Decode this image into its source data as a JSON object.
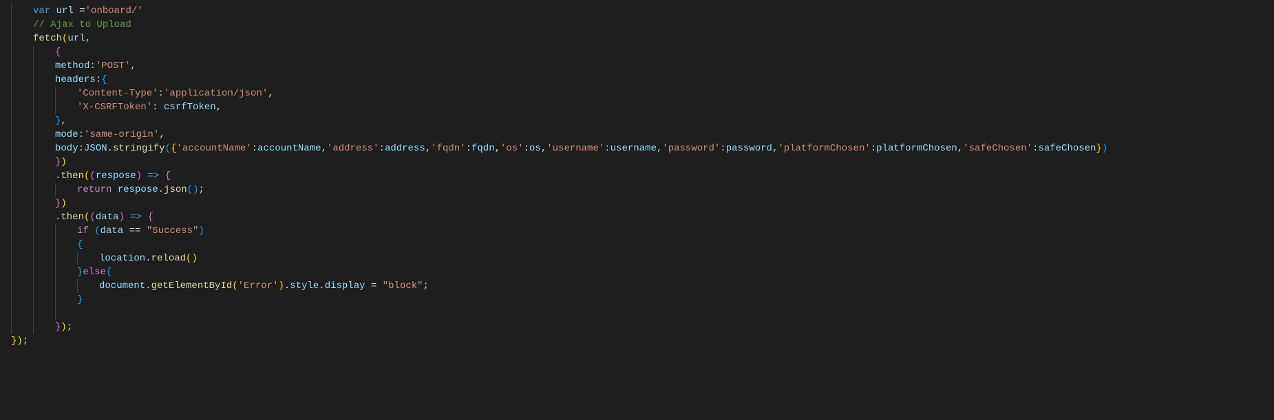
{
  "code": {
    "lines": [
      {
        "indent": 1,
        "tokens": [
          [
            "kw",
            "var"
          ],
          [
            "pn",
            " "
          ],
          [
            "id",
            "url"
          ],
          [
            "pn",
            " "
          ],
          [
            "pn",
            "="
          ],
          [
            "str",
            "'onboard/'"
          ]
        ]
      },
      {
        "indent": 1,
        "tokens": [
          [
            "cmt",
            "// Ajax to Upload"
          ]
        ]
      },
      {
        "indent": 1,
        "tokens": [
          [
            "fn",
            "fetch"
          ],
          [
            "y",
            "("
          ],
          [
            "id",
            "url"
          ],
          [
            "pn",
            ","
          ]
        ]
      },
      {
        "indent": 2,
        "tokens": [
          [
            "p",
            "{"
          ]
        ]
      },
      {
        "indent": 2,
        "tokens": [
          [
            "prop",
            "method"
          ],
          [
            "pn",
            ":"
          ],
          [
            "str",
            "'POST'"
          ],
          [
            "pn",
            ","
          ]
        ]
      },
      {
        "indent": 2,
        "tokens": [
          [
            "prop",
            "headers"
          ],
          [
            "pn",
            ":"
          ],
          [
            "b",
            "{"
          ]
        ]
      },
      {
        "indent": 3,
        "tokens": [
          [
            "str",
            "'Content-Type'"
          ],
          [
            "pn",
            ":"
          ],
          [
            "str",
            "'application/json'"
          ],
          [
            "pn",
            ","
          ]
        ]
      },
      {
        "indent": 3,
        "tokens": [
          [
            "str",
            "'X-CSRFToken'"
          ],
          [
            "pn",
            ": "
          ],
          [
            "id",
            "csrfToken"
          ],
          [
            "pn",
            ","
          ]
        ]
      },
      {
        "indent": 2,
        "tokens": [
          [
            "b",
            "}"
          ],
          [
            "pn",
            ","
          ]
        ]
      },
      {
        "indent": 2,
        "tokens": [
          [
            "prop",
            "mode"
          ],
          [
            "pn",
            ":"
          ],
          [
            "str",
            "'same-origin'"
          ],
          [
            "pn",
            ","
          ]
        ]
      },
      {
        "indent": 2,
        "tokens": [
          [
            "prop",
            "body"
          ],
          [
            "pn",
            ":"
          ],
          [
            "id",
            "JSON"
          ],
          [
            "pn",
            "."
          ],
          [
            "fn",
            "stringify"
          ],
          [
            "b",
            "("
          ],
          [
            "y",
            "{"
          ],
          [
            "str",
            "'accountName'"
          ],
          [
            "pn",
            ":"
          ],
          [
            "id",
            "accountName"
          ],
          [
            "pn",
            ","
          ],
          [
            "str",
            "'address'"
          ],
          [
            "pn",
            ":"
          ],
          [
            "id",
            "address"
          ],
          [
            "pn",
            ","
          ],
          [
            "str",
            "'fqdn'"
          ],
          [
            "pn",
            ":"
          ],
          [
            "id",
            "fqdn"
          ],
          [
            "pn",
            ","
          ],
          [
            "str",
            "'os'"
          ],
          [
            "pn",
            ":"
          ],
          [
            "id",
            "os"
          ],
          [
            "pn",
            ","
          ],
          [
            "str",
            "'username'"
          ],
          [
            "pn",
            ":"
          ],
          [
            "id",
            "username"
          ],
          [
            "pn",
            ","
          ],
          [
            "str",
            "'password'"
          ],
          [
            "pn",
            ":"
          ],
          [
            "id",
            "password"
          ],
          [
            "pn",
            ","
          ],
          [
            "str",
            "'platformChosen'"
          ],
          [
            "pn",
            ":"
          ],
          [
            "id",
            "platformChosen"
          ],
          [
            "pn",
            ","
          ],
          [
            "str",
            "'safeChosen'"
          ],
          [
            "pn",
            ":"
          ],
          [
            "id",
            "safeChosen"
          ],
          [
            "y",
            "}"
          ],
          [
            "b",
            ")"
          ]
        ]
      },
      {
        "indent": 2,
        "tokens": [
          [
            "p",
            "}"
          ],
          [
            "y",
            ")"
          ]
        ]
      },
      {
        "indent": 2,
        "tokens": [
          [
            "pn",
            "."
          ],
          [
            "fn",
            "then"
          ],
          [
            "y",
            "("
          ],
          [
            "p",
            "("
          ],
          [
            "id",
            "respose"
          ],
          [
            "p",
            ")"
          ],
          [
            "pn",
            " "
          ],
          [
            "kw",
            "=>"
          ],
          [
            "pn",
            " "
          ],
          [
            "p",
            "{"
          ]
        ]
      },
      {
        "indent": 3,
        "tokens": [
          [
            "ctl",
            "return"
          ],
          [
            "pn",
            " "
          ],
          [
            "id",
            "respose"
          ],
          [
            "pn",
            "."
          ],
          [
            "fn",
            "json"
          ],
          [
            "b",
            "("
          ],
          [
            "b",
            ")"
          ],
          [
            "pn",
            ";"
          ]
        ]
      },
      {
        "indent": 2,
        "tokens": [
          [
            "p",
            "}"
          ],
          [
            "y",
            ")"
          ]
        ]
      },
      {
        "indent": 2,
        "tokens": [
          [
            "pn",
            "."
          ],
          [
            "fn",
            "then"
          ],
          [
            "y",
            "("
          ],
          [
            "p",
            "("
          ],
          [
            "id",
            "data"
          ],
          [
            "p",
            ")"
          ],
          [
            "pn",
            " "
          ],
          [
            "kw",
            "=>"
          ],
          [
            "pn",
            " "
          ],
          [
            "p",
            "{"
          ]
        ]
      },
      {
        "indent": 3,
        "tokens": [
          [
            "ctl",
            "if"
          ],
          [
            "pn",
            " "
          ],
          [
            "b",
            "("
          ],
          [
            "id",
            "data"
          ],
          [
            "pn",
            " "
          ],
          [
            "pn",
            "=="
          ],
          [
            "pn",
            " "
          ],
          [
            "str",
            "\"Success\""
          ],
          [
            "b",
            ")"
          ]
        ]
      },
      {
        "indent": 3,
        "tokens": [
          [
            "b",
            "{"
          ]
        ]
      },
      {
        "indent": 4,
        "tokens": [
          [
            "id",
            "location"
          ],
          [
            "pn",
            "."
          ],
          [
            "fn",
            "reload"
          ],
          [
            "y",
            "("
          ],
          [
            "y",
            ")"
          ]
        ]
      },
      {
        "indent": 3,
        "tokens": [
          [
            "b",
            "}"
          ],
          [
            "ctl",
            "else"
          ],
          [
            "b",
            "{"
          ]
        ]
      },
      {
        "indent": 4,
        "tokens": [
          [
            "id",
            "document"
          ],
          [
            "pn",
            "."
          ],
          [
            "fn",
            "getElementById"
          ],
          [
            "y",
            "("
          ],
          [
            "str",
            "'Error'"
          ],
          [
            "y",
            ")"
          ],
          [
            "pn",
            "."
          ],
          [
            "id",
            "style"
          ],
          [
            "pn",
            "."
          ],
          [
            "id",
            "display"
          ],
          [
            "pn",
            " "
          ],
          [
            "pn",
            "="
          ],
          [
            "pn",
            " "
          ],
          [
            "str",
            "\"block\""
          ],
          [
            "pn",
            ";"
          ]
        ]
      },
      {
        "indent": 3,
        "tokens": [
          [
            "b",
            "}"
          ]
        ]
      },
      {
        "indent": 3,
        "tokens": [
          [
            "pn",
            ""
          ]
        ]
      },
      {
        "indent": 2,
        "tokens": [
          [
            "p",
            "}"
          ],
          [
            "y",
            ")"
          ],
          [
            "pn",
            ";"
          ]
        ]
      },
      {
        "indent": 0,
        "tokens": [
          [
            "y",
            "}"
          ],
          [
            "y",
            ")"
          ],
          [
            "pn",
            ";"
          ]
        ]
      }
    ]
  }
}
